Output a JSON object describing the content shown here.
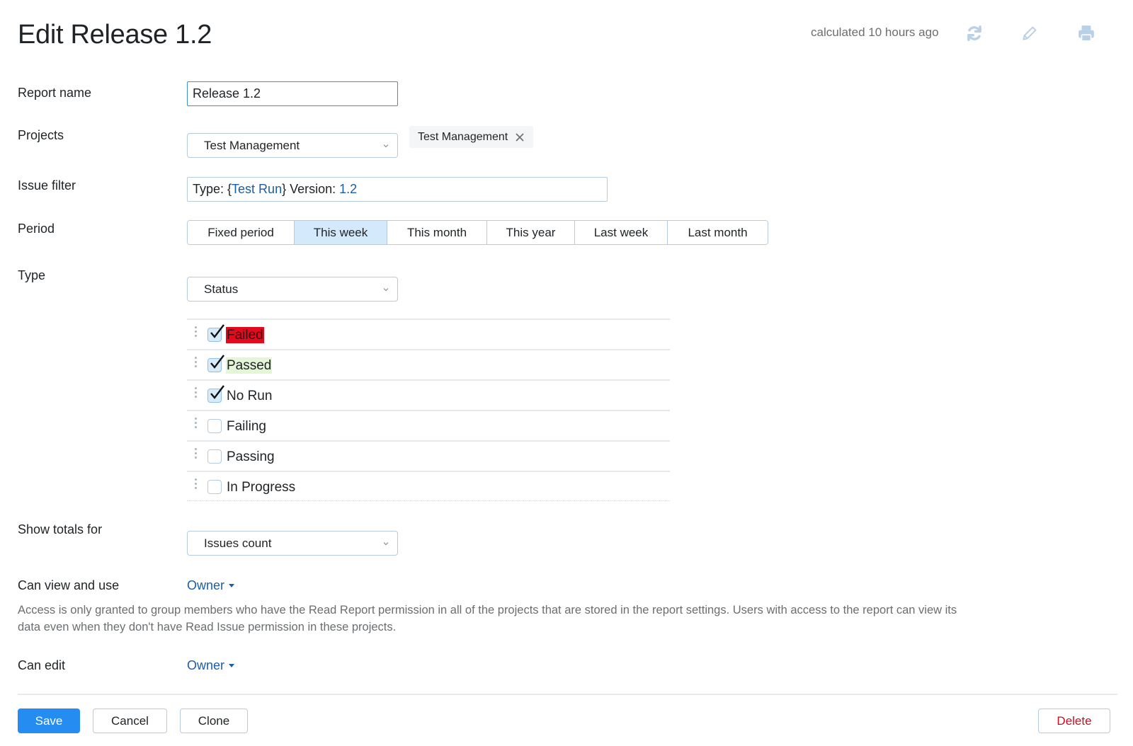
{
  "header": {
    "title": "Edit Release 1.2",
    "calculated": "calculated 10 hours ago",
    "icons": [
      "refresh-icon",
      "pencil-icon",
      "print-icon"
    ]
  },
  "form": {
    "report_name": {
      "label": "Report name",
      "value": "Release 1.2"
    },
    "projects": {
      "label": "Projects",
      "selected": "Test Management",
      "tags": [
        "Test Management"
      ]
    },
    "issue_filter": {
      "label": "Issue filter",
      "parts": [
        {
          "text": "Type: {",
          "highlight": false
        },
        {
          "text": "Test Run",
          "highlight": true
        },
        {
          "text": "} Version: ",
          "highlight": false
        },
        {
          "text": "1.2",
          "highlight": true
        }
      ]
    },
    "period": {
      "label": "Period",
      "options": [
        "Fixed period",
        "This week",
        "This month",
        "This year",
        "Last week",
        "Last month"
      ],
      "selected": "This week"
    },
    "type": {
      "label": "Type",
      "selected": "Status",
      "statuses": [
        {
          "label": "Failed",
          "checked": true,
          "color": "#e30a1e"
        },
        {
          "label": "Passed",
          "checked": true,
          "color": "#e5f6d6"
        },
        {
          "label": "No Run",
          "checked": true,
          "color": null
        },
        {
          "label": "Failing",
          "checked": false,
          "color": null
        },
        {
          "label": "Passing",
          "checked": false,
          "color": null
        },
        {
          "label": "In Progress",
          "checked": false,
          "color": null
        }
      ]
    },
    "show_totals": {
      "label": "Show totals for",
      "selected": "Issues count"
    },
    "can_view": {
      "label": "Can view and use",
      "value": "Owner"
    },
    "help_text": "Access is only granted to group members who have the Read Report permission in all of the projects that are stored in the report settings. Users with access to the report can view its data even when they don't have Read Issue permission in these projects.",
    "can_edit": {
      "label": "Can edit",
      "value": "Owner"
    }
  },
  "actions": {
    "save": "Save",
    "cancel": "Cancel",
    "clone": "Clone",
    "delete": "Delete"
  },
  "colors": {
    "accent": "#258df2",
    "link": "#1a5ea8",
    "danger": "#c41020",
    "active_period": "#d4e9fb"
  }
}
